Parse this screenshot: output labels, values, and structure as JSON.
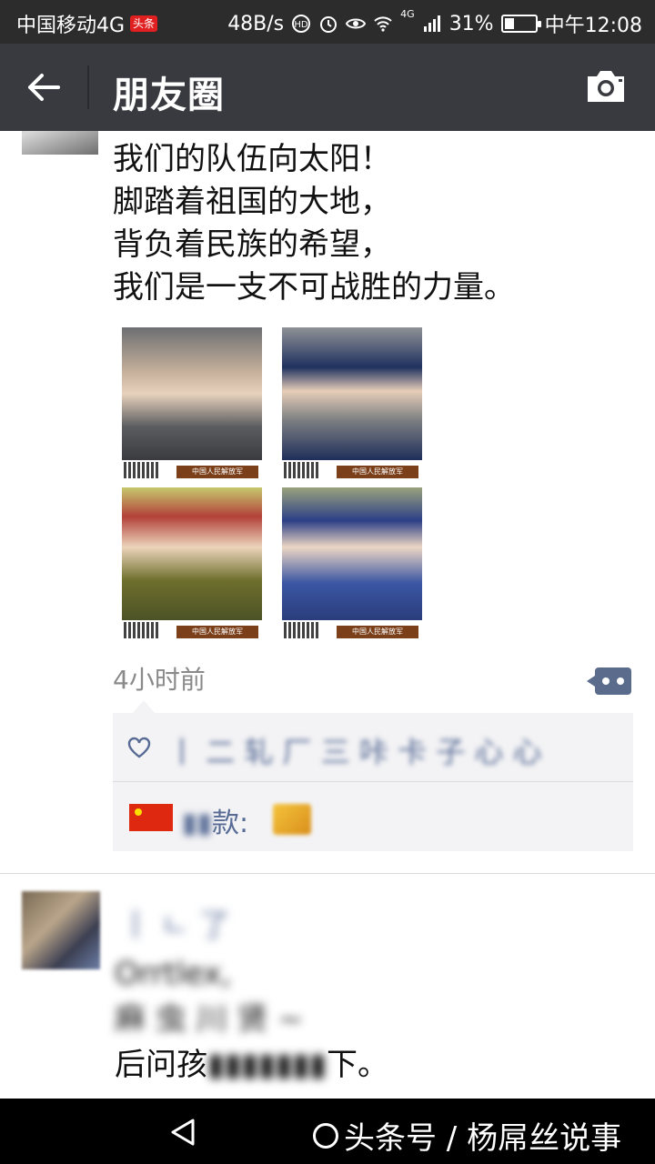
{
  "status_bar": {
    "carrier": "中国移动4G",
    "carrier_badge": "头条",
    "net_speed": "48B/s",
    "network_tag": "4G",
    "battery": "31%",
    "battery_level": 0.31,
    "time": "中午12:08"
  },
  "header": {
    "title": "朋友圈",
    "back_icon": "back-arrow-icon",
    "camera_icon": "camera-icon",
    "bg_color": "#393a3f"
  },
  "post1": {
    "lines": [
      "我们的队伍向太阳！",
      "脚踏着祖国的大地，",
      "背负着民族的希望，",
      "我们是一支不可战胜的力量。"
    ],
    "photo_caption": "中国人民解放军",
    "timestamp": "4小时前",
    "likes_text": "丨 二 轧 厂 三 咔 卡 子 心 心",
    "comment_author_visible": "款:",
    "link_color": "#576b95"
  },
  "post2": {
    "name": "丨 ㄴ 了",
    "lines": [
      "Orrtlex,",
      "麻 虫 川 贤 ~",
      "后问孩"
    ],
    "line3_tail": "下。"
  },
  "nav_bar": {
    "watermark": "头条号 / 杨屌丝说事"
  }
}
